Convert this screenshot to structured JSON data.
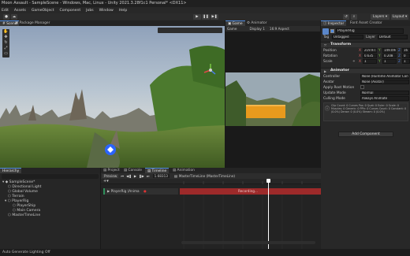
{
  "window": {
    "title": "Moon Assault - SampleScene - Windows, Mac, Linux - Unity 2021.3.28f1c1 Personal* <DX11>"
  },
  "menu": [
    "Edit",
    "Assets",
    "GameObject",
    "Component",
    "Jobs",
    "Window",
    "Help"
  ],
  "toolbar": {
    "layers_label": "Layers",
    "layout_label": "Layout"
  },
  "top_tabs": {
    "scene": "Scene",
    "package_manager": "Package Manager"
  },
  "game_tabs": {
    "game": "Game",
    "animator": "Animator"
  },
  "game_bar": {
    "mode": "Game",
    "display": "Display 1",
    "aspect": "16:9 Aspect"
  },
  "inspector": {
    "tab": "Inspector",
    "tab2": "Font Asset Creator",
    "object_name": "PlayerRig",
    "tag_label": "Tag",
    "tag_value": "Untagged",
    "layer_label": "Layer",
    "layer_value": "Default",
    "transform": {
      "title": "Transform",
      "position_label": "Position",
      "rotation_label": "Rotation",
      "scale_label": "Scale",
      "position": {
        "x": "219.973",
        "y": "149.094",
        "z": "16"
      },
      "rotation": {
        "x": "0.635",
        "y": "0.208",
        "z": "0"
      },
      "scale": {
        "x": "1",
        "y": "1",
        "z": "1"
      }
    },
    "animator": {
      "title": "Animator",
      "controller_label": "Controller",
      "controller_value": "None (Runtime Animator Controller)",
      "avatar_label": "Avatar",
      "avatar_value": "None (Avatar)",
      "root_motion_label": "Apply Root Motion",
      "update_mode_label": "Update Mode",
      "update_mode_value": "Normal",
      "culling_label": "Culling Mode",
      "culling_value": "Always Animate",
      "info": "Clip Count: 0  Curves Pos: 0 Quat: 0 Euler: 0 Scale: 0  Muscles: 0 Generic: 0 PPtr: 0  Curves Count: 0 Constant: 0 (0.0%) Dense: 0 (0.0%) Stream: 0 (0.0%)"
    },
    "add_component": "Add Component"
  },
  "hierarchy": {
    "tab": "Hierarchy",
    "items": [
      {
        "label": "SampleScene*",
        "depth": 0
      },
      {
        "label": "Directional Light",
        "depth": 1
      },
      {
        "label": "Global Volume",
        "depth": 1
      },
      {
        "label": "Terrain",
        "depth": 1
      },
      {
        "label": "PlayerRig",
        "depth": 1
      },
      {
        "label": "PlayerShip",
        "depth": 2
      },
      {
        "label": "Main Camera",
        "depth": 2
      },
      {
        "label": "MasterTimeLine",
        "depth": 1
      }
    ]
  },
  "bottom_tabs": {
    "project": "Project",
    "console": "Console",
    "timeline": "Timeline",
    "animation": "Animation"
  },
  "timeline": {
    "preview": "Preview",
    "frame": "1.68313",
    "asset": "MasterTimeLine (MasterTimeLine)",
    "track_label": "PlayerRig (Anima",
    "recording": "Recording..."
  },
  "status": {
    "text": "Auto Generate Lighting Off"
  },
  "colors": {
    "accent": "#4f8be0",
    "record_red": "#9d2a2a",
    "cube": "#e89a1d"
  }
}
